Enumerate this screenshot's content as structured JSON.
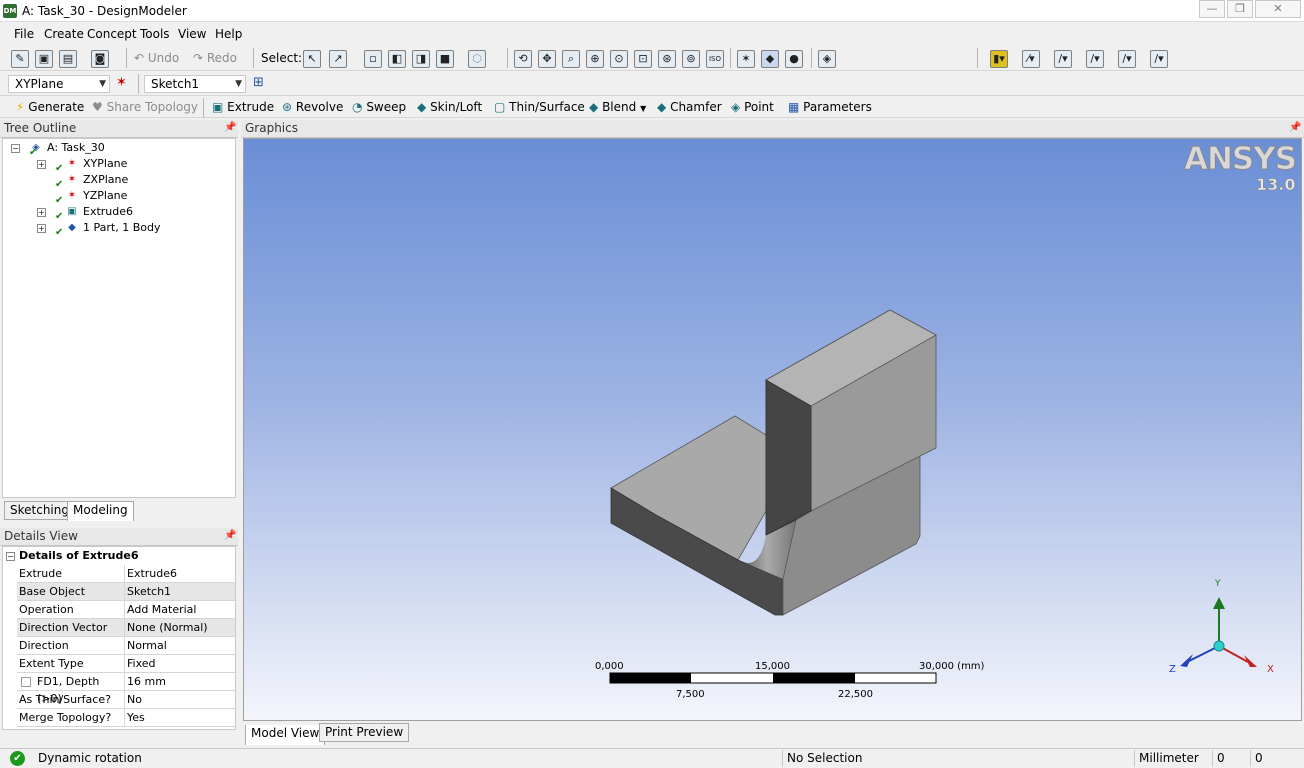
{
  "window": {
    "title": "A: Task_30 - DesignModeler",
    "app_icon": "DM",
    "min_icon": "minimize-icon",
    "max_icon": "maximize-icon",
    "close_icon": "close-icon"
  },
  "menu": [
    "File",
    "Create",
    "Concept",
    "Tools",
    "View",
    "Help"
  ],
  "toolbar1": {
    "undo": "Undo",
    "redo": "Redo",
    "select": "Select:"
  },
  "toolbar2": {
    "plane": "XYPlane",
    "sketch": "Sketch1"
  },
  "toolbar3": {
    "generate": "Generate",
    "share_topology": "Share Topology",
    "extrude": "Extrude",
    "revolve": "Revolve",
    "sweep": "Sweep",
    "skin_loft": "Skin/Loft",
    "thin_surface": "Thin/Surface",
    "blend": "Blend",
    "chamfer": "Chamfer",
    "point": "Point",
    "parameters": "Parameters"
  },
  "tree": {
    "title": "Tree Outline",
    "root": "A: Task_30",
    "items": [
      "XYPlane",
      "ZXPlane",
      "YZPlane",
      "Extrude6",
      "1 Part, 1 Body"
    ]
  },
  "tabs": {
    "sketching": "Sketching",
    "modeling": "Modeling"
  },
  "details": {
    "title": "Details View",
    "header": "Details of Extrude6",
    "rows": [
      {
        "k": "Extrude",
        "v": "Extrude6"
      },
      {
        "k": "Base Object",
        "v": "Sketch1"
      },
      {
        "k": "Operation",
        "v": "Add Material"
      },
      {
        "k": "Direction Vector",
        "v": "None (Normal)"
      },
      {
        "k": "Direction",
        "v": "Normal"
      },
      {
        "k": "Extent Type",
        "v": "Fixed"
      },
      {
        "k": "FD1,  Depth (>0)",
        "v": "16 mm"
      },
      {
        "k": "As Thin/Surface?",
        "v": "No"
      },
      {
        "k": "Merge Topology?",
        "v": "Yes"
      }
    ]
  },
  "graphics": {
    "title": "Graphics",
    "logo": "ANSYS",
    "version": "13.0",
    "scale_top": [
      "0,000",
      "15,000",
      "30,000 (mm)"
    ],
    "scale_bottom": [
      "7,500",
      "22,500"
    ],
    "axes": {
      "y": "Y",
      "x": "X",
      "z": "Z"
    }
  },
  "bottom_tabs": {
    "model_view": "Model View",
    "print_preview": "Print Preview"
  },
  "status": {
    "message": "Dynamic rotation",
    "selection": "No Selection",
    "units": "Millimeter",
    "val1": "0",
    "val2": "0"
  }
}
